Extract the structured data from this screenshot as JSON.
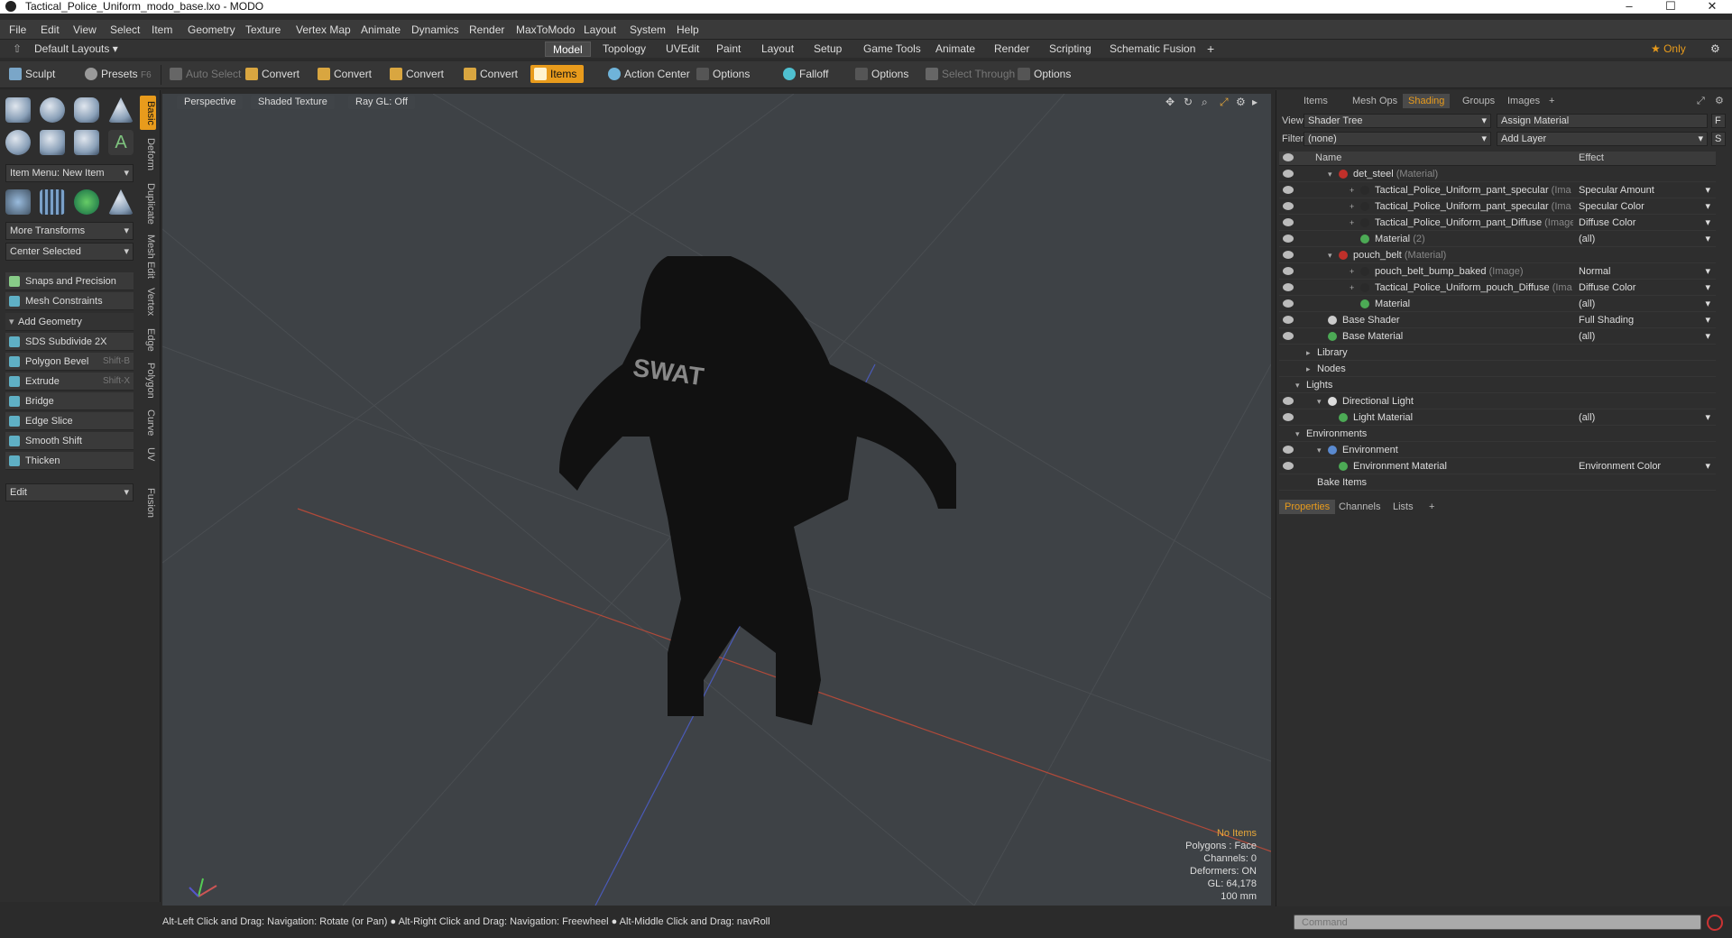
{
  "window": {
    "title": "Tactical_Police_Uniform_modo_base.lxo - MODO",
    "min": "–",
    "max": "☐",
    "close": "✕"
  },
  "menu": [
    "File",
    "Edit",
    "View",
    "Select",
    "Item",
    "Geometry",
    "Texture",
    "Vertex Map",
    "Animate",
    "Dynamics",
    "Render",
    "MaxToModo",
    "Layout",
    "System",
    "Help"
  ],
  "layout_bar": {
    "layouts_label": "Default Layouts ▾",
    "tabs": [
      "Model",
      "Topology",
      "UVEdit",
      "Paint",
      "Layout",
      "Setup",
      "Game Tools",
      "Animate",
      "Render",
      "Scripting",
      "Schematic Fusion"
    ],
    "active": "Model",
    "plus": "+",
    "only_label": "★ Only",
    "gear": "⚙"
  },
  "toolbar": {
    "sculpt": "Sculpt",
    "presets": "Presets",
    "presets_key": "F6",
    "auto_select": "Auto Select",
    "convert": "Convert",
    "items": "Items",
    "action_center": "Action Center",
    "options": "Options",
    "falloff": "Falloff",
    "select_through": "Select Through"
  },
  "left": {
    "item_menu": "Item Menu: New Item",
    "more_transforms": "More Transforms",
    "center_selected": "Center Selected",
    "snaps": "Snaps and Precision",
    "mesh_constraints": "Mesh Constraints",
    "add_geometry": "Add Geometry",
    "tools": [
      {
        "label": "SDS Subdivide 2X",
        "key": ""
      },
      {
        "label": "Polygon Bevel",
        "key": "Shift-B"
      },
      {
        "label": "Extrude",
        "key": "Shift-X"
      },
      {
        "label": "Bridge",
        "key": ""
      },
      {
        "label": "Edge Slice",
        "key": ""
      },
      {
        "label": "Smooth Shift",
        "key": ""
      },
      {
        "label": "Thicken",
        "key": ""
      }
    ],
    "edit": "Edit",
    "vtabs": [
      "Basic",
      "Deform",
      "Duplicate",
      "Mesh Edit",
      "Vertex",
      "Edge",
      "Polygon",
      "Curve",
      "UV",
      "Fusion"
    ]
  },
  "viewport": {
    "view_mode": "Perspective",
    "shading": "Shaded Texture",
    "raygl": "Ray GL: Off",
    "model_text": "SWAT",
    "info": {
      "items": "No Items",
      "polygons": "Polygons : Face",
      "channels": "Channels: 0",
      "deformers": "Deformers: ON",
      "gl": "GL: 64,178",
      "scale": "100 mm"
    }
  },
  "right": {
    "tabs": [
      "Items",
      "Mesh Ops",
      "Shading",
      "Groups",
      "Images"
    ],
    "active_tab": "Shading",
    "view_label": "View",
    "view_value": "Shader Tree",
    "assign_material": "Assign Material",
    "filter_label": "Filter",
    "filter_value": "(none)",
    "add_layer": "Add Layer",
    "col_name": "Name",
    "col_effect": "Effect",
    "rows": [
      {
        "name": "det_steel",
        "type": "(Material)",
        "effect": "",
        "indent": 3,
        "color": "#c0302a",
        "exp": "▾"
      },
      {
        "name": "Tactical_Police_Uniform_pant_specular",
        "type": "(Ima ...",
        "effect": "Specular Amount",
        "indent": 5,
        "color": "#2a2a2a",
        "exp": "+"
      },
      {
        "name": "Tactical_Police_Uniform_pant_specular",
        "type": "(Ima ...",
        "effect": "Specular Color",
        "indent": 5,
        "color": "#2a2a2a",
        "exp": "+"
      },
      {
        "name": "Tactical_Police_Uniform_pant_Diffuse",
        "type": "(Image)",
        "effect": "Diffuse Color",
        "indent": 5,
        "color": "#2a2a2a",
        "exp": "+"
      },
      {
        "name": "Material",
        "type": "(2)",
        "effect": "(all)",
        "indent": 5,
        "color": "#4caa55",
        "exp": ""
      },
      {
        "name": "pouch_belt",
        "type": "(Material)",
        "effect": "",
        "indent": 3,
        "color": "#c0302a",
        "exp": "▾"
      },
      {
        "name": "pouch_belt_bump_baked",
        "type": "(Image)",
        "effect": "Normal",
        "indent": 5,
        "color": "#2a2a2a",
        "exp": "+"
      },
      {
        "name": "Tactical_Police_Uniform_pouch_Diffuse",
        "type": "(Ima ...",
        "effect": "Diffuse Color",
        "indent": 5,
        "color": "#2a2a2a",
        "exp": "+"
      },
      {
        "name": "Material",
        "type": "",
        "effect": "(all)",
        "indent": 5,
        "color": "#4caa55",
        "exp": ""
      },
      {
        "name": "Base Shader",
        "type": "",
        "effect": "Full Shading",
        "indent": 2,
        "color": "#cccccc",
        "exp": ""
      },
      {
        "name": "Base Material",
        "type": "",
        "effect": "(all)",
        "indent": 2,
        "color": "#4caa55",
        "exp": ""
      },
      {
        "name": "Library",
        "type": "",
        "effect": "",
        "indent": 1,
        "color": "",
        "exp": "▸"
      },
      {
        "name": "Nodes",
        "type": "",
        "effect": "",
        "indent": 1,
        "color": "",
        "exp": "▸"
      },
      {
        "name": "Lights",
        "type": "",
        "effect": "",
        "indent": 0,
        "color": "",
        "exp": "▾"
      },
      {
        "name": "Directional Light",
        "type": "",
        "effect": "",
        "indent": 2,
        "color": "#dddddd",
        "exp": "▾"
      },
      {
        "name": "Light Material",
        "type": "",
        "effect": "(all)",
        "indent": 3,
        "color": "#4caa55",
        "exp": ""
      },
      {
        "name": "Environments",
        "type": "",
        "effect": "",
        "indent": 0,
        "color": "",
        "exp": "▾"
      },
      {
        "name": "Environment",
        "type": "",
        "effect": "",
        "indent": 2,
        "color": "#5a8ad0",
        "exp": "▾"
      },
      {
        "name": "Environment Material",
        "type": "",
        "effect": "Environment Color",
        "indent": 3,
        "color": "#4caa55",
        "exp": ""
      },
      {
        "name": "Bake Items",
        "type": "",
        "effect": "",
        "indent": 1,
        "color": "",
        "exp": ""
      }
    ],
    "prop_tabs": [
      "Properties",
      "Channels",
      "Lists"
    ],
    "prop_active": "Properties"
  },
  "status": "Alt-Left Click and Drag: Navigation: Rotate (or Pan) ● Alt-Right Click and Drag: Navigation: Freewheel ● Alt-Middle Click and Drag: navRoll",
  "command_placeholder": "Command",
  "accent": "#e89b1c"
}
